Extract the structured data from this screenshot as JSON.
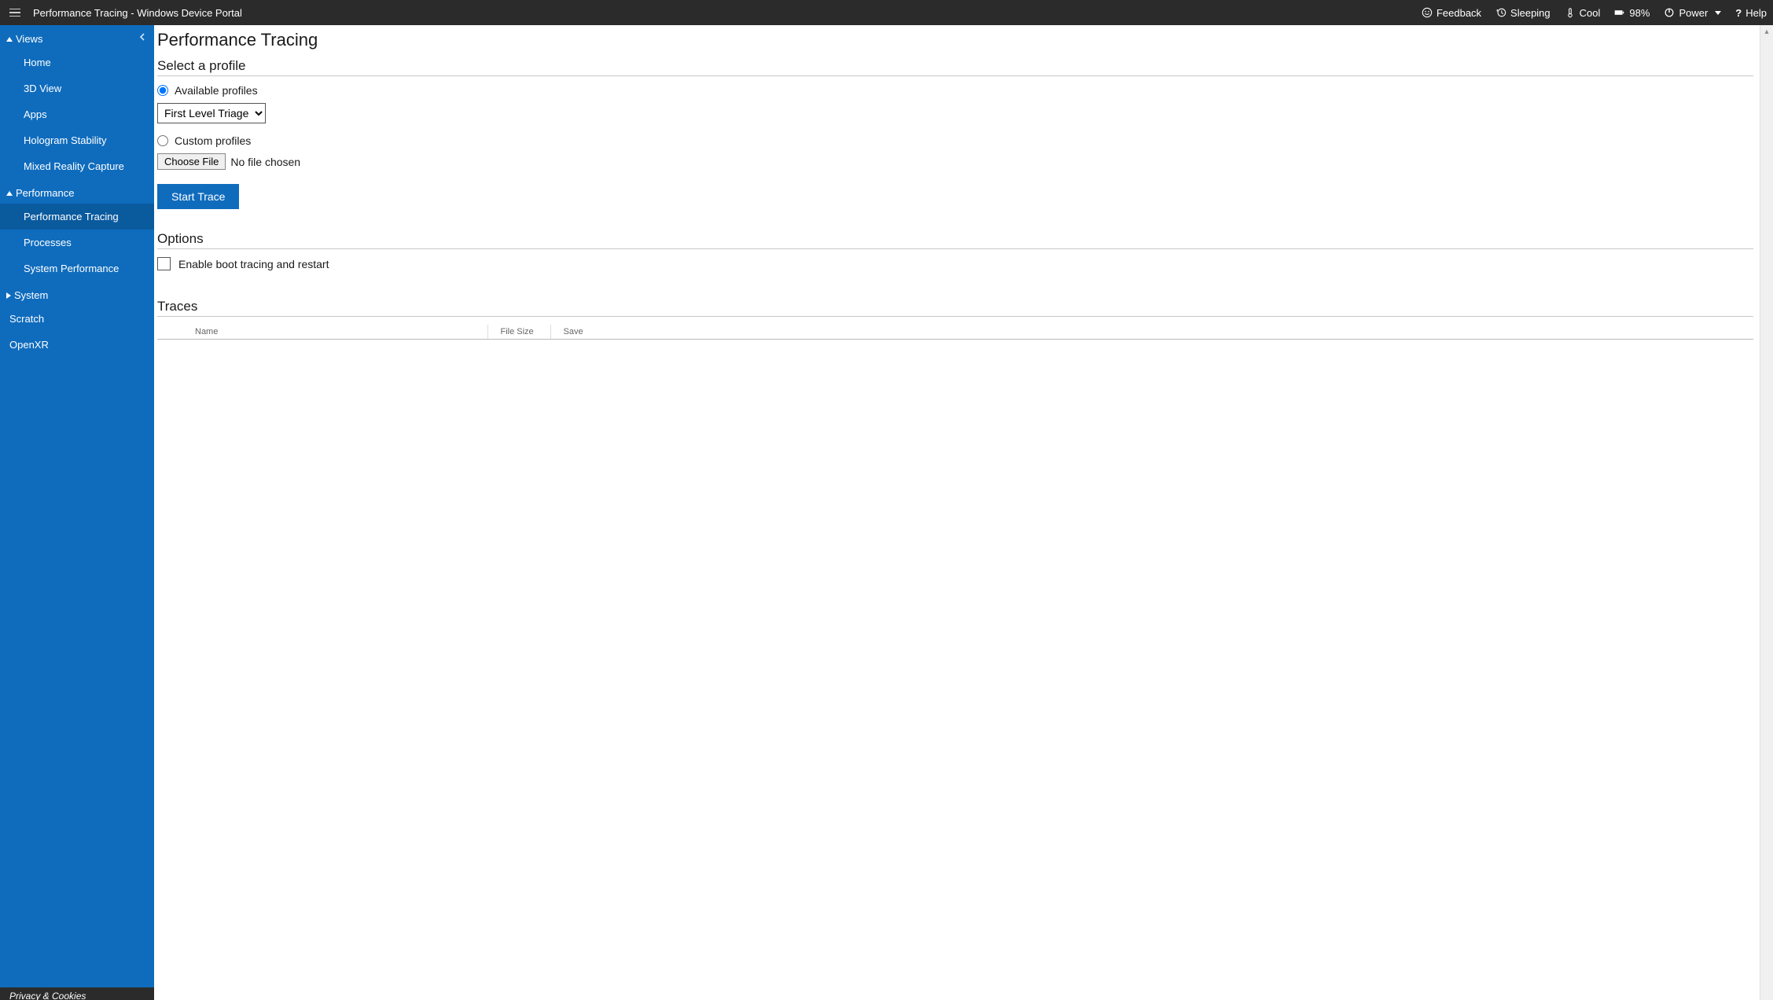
{
  "topbar": {
    "title": "Performance Tracing - Windows Device Portal",
    "feedback": "Feedback",
    "sleeping": "Sleeping",
    "cool": "Cool",
    "battery": "98%",
    "power": "Power",
    "help": "Help"
  },
  "sidebar": {
    "views": {
      "label": "Views",
      "items": [
        "Home",
        "3D View",
        "Apps",
        "Hologram Stability",
        "Mixed Reality Capture"
      ]
    },
    "performance": {
      "label": "Performance",
      "items": [
        "Performance Tracing",
        "Processes",
        "System Performance"
      ]
    },
    "system": {
      "label": "System"
    },
    "scratch": "Scratch",
    "openxr": "OpenXR",
    "footer": "Privacy & Cookies"
  },
  "content": {
    "title": "Performance Tracing",
    "select_profile": "Select a profile",
    "available_profiles": "Available profiles",
    "profile_selected": "First Level Triage",
    "custom_profiles": "Custom profiles",
    "choose_file": "Choose File",
    "no_file": "No file chosen",
    "start_trace": "Start Trace",
    "options": "Options",
    "enable_boot": "Enable boot tracing and restart",
    "traces": "Traces",
    "table": {
      "name": "Name",
      "file_size": "File Size",
      "save": "Save"
    }
  }
}
